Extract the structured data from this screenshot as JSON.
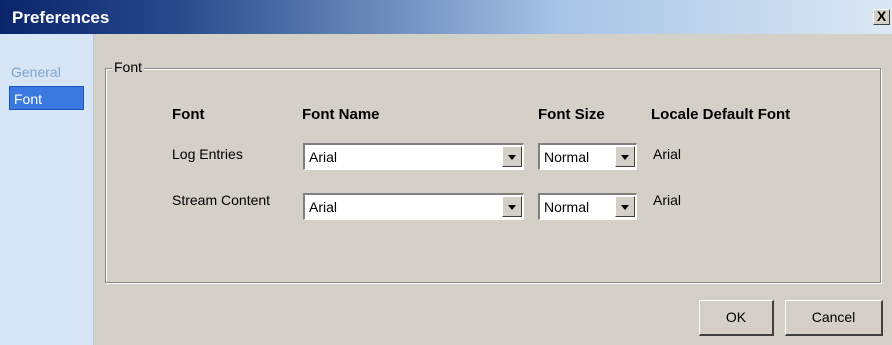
{
  "window": {
    "title": "Preferences",
    "close_label": "X"
  },
  "sidebar": {
    "items": [
      {
        "label": "General",
        "selected": false
      },
      {
        "label": "Font",
        "selected": true
      }
    ]
  },
  "font_group": {
    "title": "Font",
    "headers": {
      "font": "Font",
      "font_name": "Font Name",
      "font_size": "Font Size",
      "locale_default": "Locale Default Font"
    },
    "rows": [
      {
        "label": "Log Entries",
        "font_name": "Arial",
        "font_size": "Normal",
        "locale_default": "Arial"
      },
      {
        "label": "Stream Content",
        "font_name": "Arial",
        "font_size": "Normal",
        "locale_default": "Arial"
      }
    ]
  },
  "buttons": {
    "ok": "OK",
    "cancel": "Cancel"
  },
  "colors": {
    "selection": "#3a7ae0",
    "sidebar_bg": "#d6e6f6",
    "dialog_bg": "#d4d0c8",
    "title_dark": "#0a246a"
  }
}
